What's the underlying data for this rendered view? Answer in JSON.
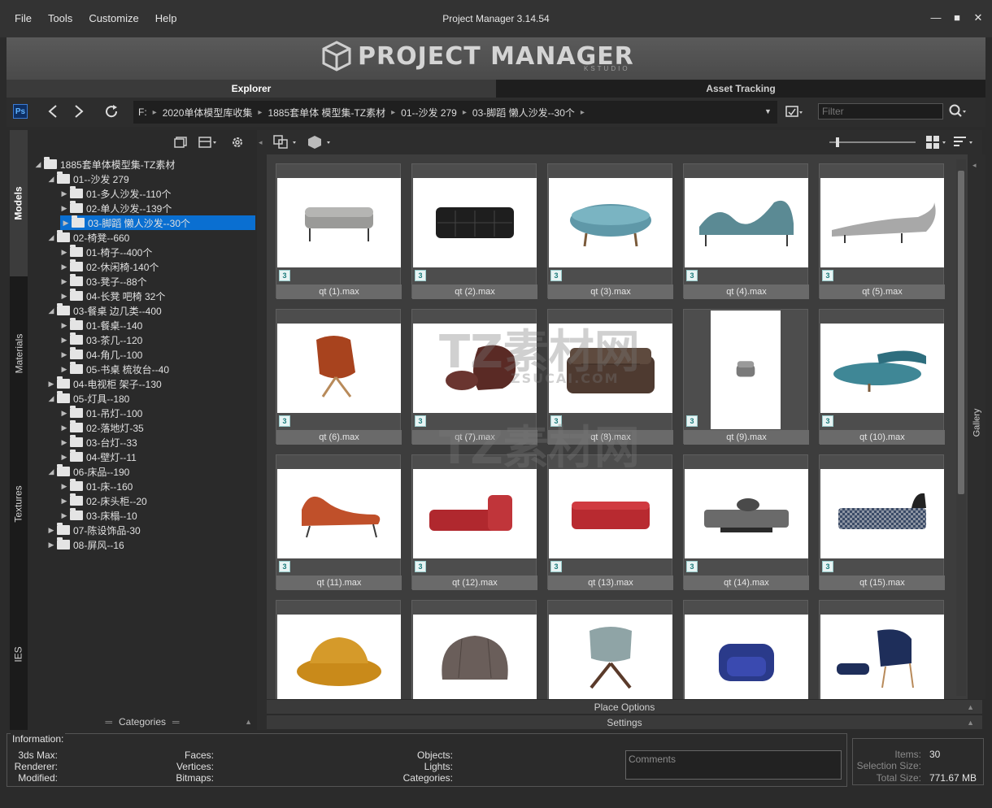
{
  "menu": [
    "File",
    "Tools",
    "Customize",
    "Help"
  ],
  "app_title": "Project Manager 3.14.54",
  "window_controls": {
    "minimize": "—",
    "maximize": "■",
    "close": "✕"
  },
  "banner": {
    "logo_text": "PROJECT MANAGER",
    "logo_sub": "KSTUDIO"
  },
  "tabs": {
    "explorer": "Explorer",
    "asset_tracking": "Asset Tracking"
  },
  "nav": {
    "ps_label": "Ps",
    "path": [
      "F:",
      "2020单体模型库收集",
      "1885套单体 模型集-TZ素材",
      "01--沙发 279",
      "03-脚蹈 懒人沙发--30个"
    ],
    "filter_placeholder": "Filter"
  },
  "side_tabs": [
    "Models",
    "Materials",
    "Textures",
    "IES"
  ],
  "tree": [
    {
      "label": "1885套单体模型集-TZ素材",
      "level": 0,
      "expanded": true
    },
    {
      "label": "01--沙发 279",
      "level": 1,
      "expanded": true
    },
    {
      "label": "01-多人沙发--110个",
      "level": 2,
      "expanded": false
    },
    {
      "label": "02-单人沙发--139个",
      "level": 2,
      "expanded": false
    },
    {
      "label": "03-脚蹈 懒人沙发--30个",
      "level": 2,
      "expanded": false,
      "selected": true
    },
    {
      "label": "02-椅凳--660",
      "level": 1,
      "expanded": true
    },
    {
      "label": "01-椅子--400个",
      "level": 2,
      "expanded": false
    },
    {
      "label": "02-休闲椅-140个",
      "level": 2,
      "expanded": false
    },
    {
      "label": "03-凳子--88个",
      "level": 2,
      "expanded": false
    },
    {
      "label": "04-长凳 吧椅 32个",
      "level": 2,
      "expanded": false
    },
    {
      "label": "03-餐桌 边几类--400",
      "level": 1,
      "expanded": true
    },
    {
      "label": "01-餐桌--140",
      "level": 2,
      "expanded": false
    },
    {
      "label": "03-茶几--120",
      "level": 2,
      "expanded": false
    },
    {
      "label": "04-角几--100",
      "level": 2,
      "expanded": false
    },
    {
      "label": "05-书桌 梳妆台--40",
      "level": 2,
      "expanded": false
    },
    {
      "label": "04-电视柜 架子--130",
      "level": 1,
      "expanded": false
    },
    {
      "label": "05-灯具--180",
      "level": 1,
      "expanded": true
    },
    {
      "label": "01-吊灯--100",
      "level": 2,
      "expanded": false
    },
    {
      "label": "02-落地灯-35",
      "level": 2,
      "expanded": false
    },
    {
      "label": "03-台灯--33",
      "level": 2,
      "expanded": false
    },
    {
      "label": "04-壁灯--11",
      "level": 2,
      "expanded": false
    },
    {
      "label": "06-床品--190",
      "level": 1,
      "expanded": true
    },
    {
      "label": "01-床--160",
      "level": 2,
      "expanded": false
    },
    {
      "label": "02-床头柜--20",
      "level": 2,
      "expanded": false
    },
    {
      "label": "03-床榻--10",
      "level": 2,
      "expanded": false
    },
    {
      "label": "07-陈设饰品-30",
      "level": 1,
      "expanded": false
    },
    {
      "label": "08-屏风--16",
      "level": 1,
      "expanded": false
    }
  ],
  "categories_label": "Categories",
  "gallery_side_label": "Gallery",
  "badge": "3",
  "items": [
    {
      "name": "qt (1).max",
      "shape": "ottoman-grey",
      "color": "#9a9a98"
    },
    {
      "name": "qt (2).max",
      "shape": "ottoman-black",
      "color": "#1e1e1e"
    },
    {
      "name": "qt (3).max",
      "shape": "pouf-round",
      "color": "#5f98a8"
    },
    {
      "name": "qt (4).max",
      "shape": "chaise-wave",
      "color": "#5b8a94"
    },
    {
      "name": "qt (5).max",
      "shape": "chaise-long",
      "color": "#a8a8a8"
    },
    {
      "name": "qt (6).max",
      "shape": "lounge-chair",
      "color": "#a8431e"
    },
    {
      "name": "qt (7).max",
      "shape": "beanbag",
      "color": "#5a2a25"
    },
    {
      "name": "qt (8).max",
      "shape": "sofa-bed",
      "color": "#4e3a30"
    },
    {
      "name": "qt (9).max",
      "shape": "small-chair",
      "color": "#7a7a7a"
    },
    {
      "name": "qt (10).max",
      "shape": "round-daybed",
      "color": "#3f8796"
    },
    {
      "name": "qt (11).max",
      "shape": "chaise-orange",
      "color": "#c0502a"
    },
    {
      "name": "qt (12).max",
      "shape": "daybed-red",
      "color": "#b0282e"
    },
    {
      "name": "qt (13).max",
      "shape": "bench-red",
      "color": "#b82a30"
    },
    {
      "name": "qt (14).max",
      "shape": "daybed-grey",
      "color": "#6a6a6a"
    },
    {
      "name": "qt (15).max",
      "shape": "bench-pattern",
      "color": "#3a4a66"
    },
    {
      "name": "",
      "shape": "round-chair-yellow",
      "color": "#c98a1a"
    },
    {
      "name": "",
      "shape": "armchair-taupe",
      "color": "#6a5e5a"
    },
    {
      "name": "",
      "shape": "swivel-chair",
      "color": "#8fa4a6"
    },
    {
      "name": "",
      "shape": "club-chair-blue",
      "color": "#2a3a8a"
    },
    {
      "name": "",
      "shape": "lounge-ottoman-navy",
      "color": "#1e2e5a"
    }
  ],
  "strips": {
    "place_options": "Place Options",
    "settings": "Settings"
  },
  "info": {
    "title": "Information:",
    "col1": [
      "3ds Max:",
      "Renderer:",
      "Modified:"
    ],
    "col2": [
      "Faces:",
      "Vertices:",
      "Bitmaps:"
    ],
    "col3": [
      "Objects:",
      "Lights:",
      "Categories:"
    ],
    "comments_placeholder": "Comments"
  },
  "stats": {
    "items_label": "Items:",
    "items_value": "30",
    "selection_label": "Selection Size:",
    "selection_value": "",
    "total_label": "Total Size:",
    "total_value": "771.67 MB"
  },
  "watermark": {
    "text": "TZ素材网",
    "sub": "ZSUCAI.COM"
  }
}
